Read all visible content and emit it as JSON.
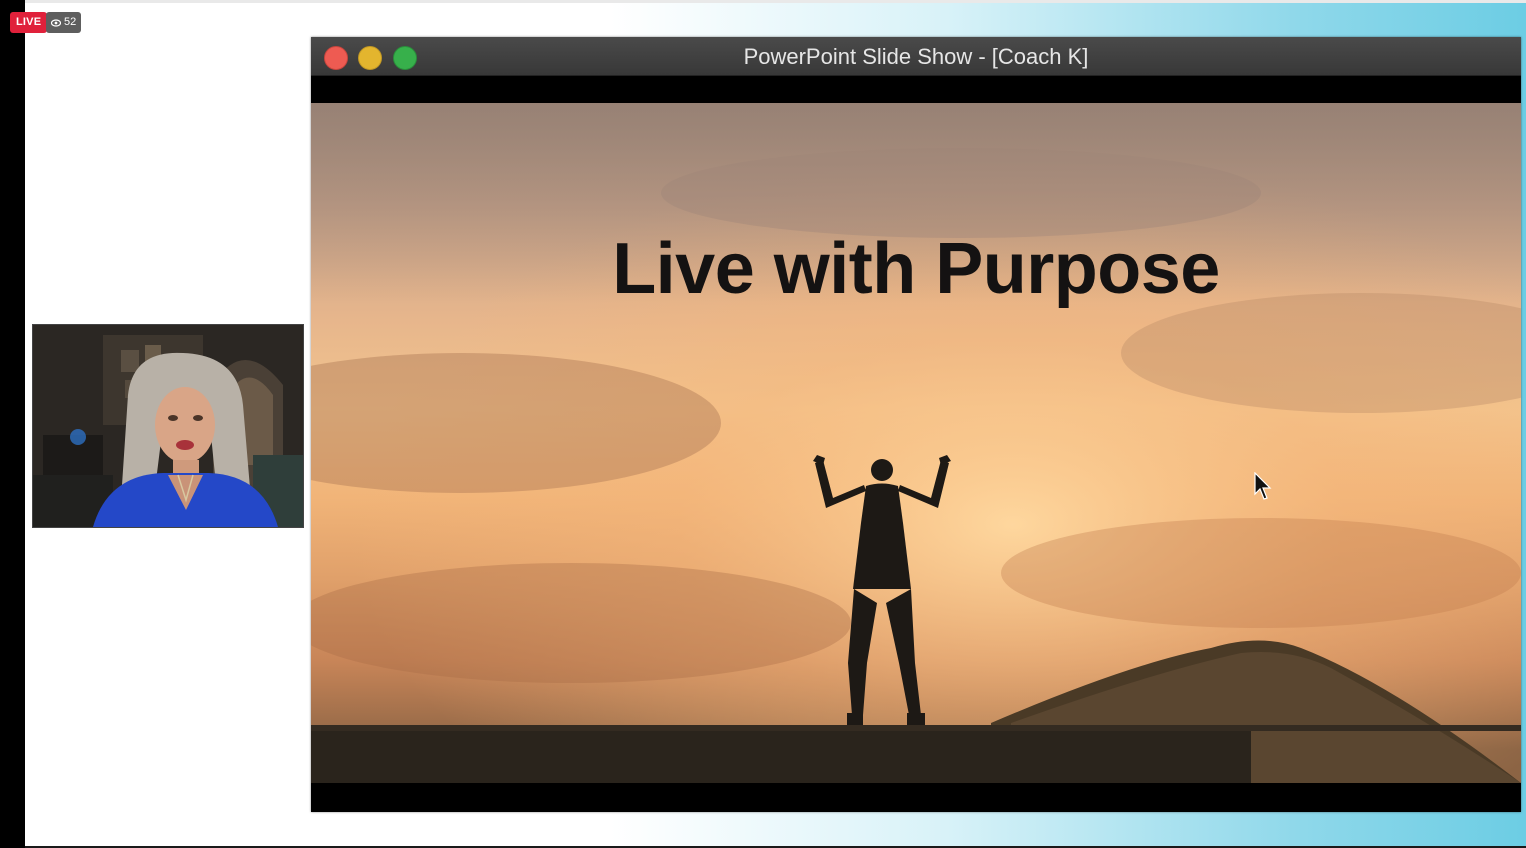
{
  "stream": {
    "live_label": "LIVE",
    "viewer_count": "52",
    "viewer_icon": "eye-icon"
  },
  "window": {
    "title": "PowerPoint Slide Show - [Coach K]",
    "controls": [
      "close",
      "minimize",
      "maximize"
    ],
    "colors": {
      "close": "#ee5b52",
      "minimize": "#e3b52e",
      "maximize": "#37b04b"
    }
  },
  "slide": {
    "title": "Live with Purpose"
  },
  "colors": {
    "live_badge": "#e0213b",
    "background_accent": "#6ccde4"
  }
}
